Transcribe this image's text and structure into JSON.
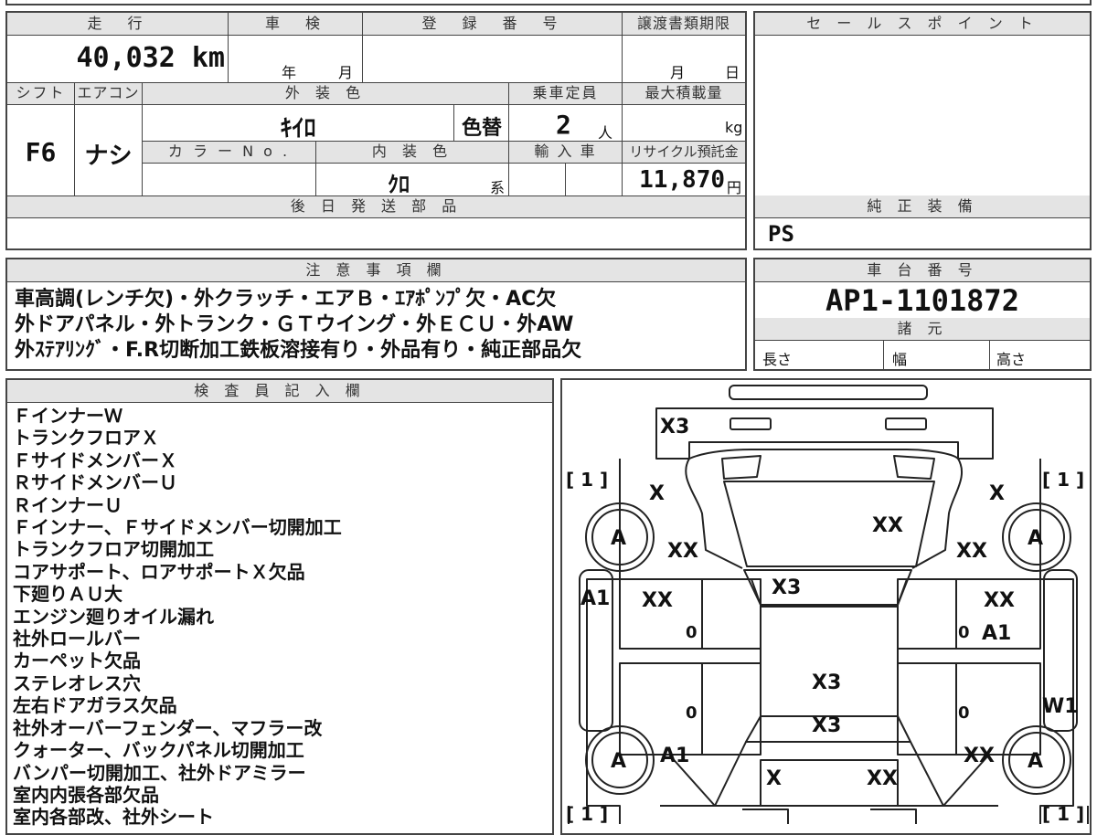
{
  "top_table": {
    "hdr_mileage": "走　行",
    "mileage": "40,032 km",
    "hdr_shaken": "車　検",
    "shaken_year": "年",
    "shaken_month": "月",
    "hdr_reg": "登　録　番　号",
    "hdr_transfer": "譲渡書類期限",
    "transfer_month": "月",
    "transfer_day": "日",
    "hdr_shift": "シフト",
    "shift": "F6",
    "hdr_ac": "エアコン",
    "ac": "ナシ",
    "hdr_exterior": "外 装 色",
    "exterior_color": "ｷｲﾛ",
    "color_change": "色替",
    "hdr_capacity": "乗車定員",
    "capacity": "2",
    "capacity_unit": "人",
    "hdr_maxload": "最大積載量",
    "maxload_unit": "kg",
    "hdr_colorno": "カ ラ ー N o .",
    "hdr_interior": "内 装 色",
    "interior_color": "ｸﾛ",
    "interior_suffix": "系",
    "hdr_import": "輸 入 車",
    "hdr_recycle": "リサイクル預託金",
    "recycle": "11,870",
    "recycle_unit": "円",
    "hdr_later_parts": "後 日 発 送 部 品"
  },
  "sales_point": {
    "header": "セ ー ル ス ポ イ ン ト"
  },
  "genuine_equipment": {
    "header": "純 正 装 備",
    "value": "PS"
  },
  "notes": {
    "header": "注 意 事 項 欄",
    "lines": [
      "車高調(レンチ欠)・外クラッチ・エアＢ・ｴｱﾎﾟﾝﾌﾟ欠・AC欠",
      "外ドアパネル・外トランク・ＧＴウイング・外ＥＣＵ・外AW",
      "外ｽﾃｱﾘﾝｸﾞ・F.R切断加工鉄板溶接有り・外品有り・純正部品欠"
    ]
  },
  "chassis": {
    "header": "車 台 番 号",
    "number": "AP1-1101872",
    "spec_header": "諸 元",
    "length": "長さ",
    "width": "幅",
    "height": "高さ"
  },
  "inspector": {
    "header": "検 査 員 記 入 欄",
    "lines": [
      "ＦインナーＷ",
      "トランクフロアＸ",
      "ＦサイドメンバーＸ",
      "ＲサイドメンバーＵ",
      "ＲインナーＵ",
      "Ｆインナー、Ｆサイドメンバー切開加工",
      "トランクフロア切開加工",
      "コアサポート、ロアサポートＸ欠品",
      "下廻りＡＵ大",
      "エンジン廻りオイル漏れ",
      "社外ロールバー",
      "カーペット欠品",
      "ステレオレス穴",
      "左右ドアガラス欠品",
      "社外オーバーフェンダー、マフラー改",
      "クォーター、バックパネル切開加工",
      "バンパー切開加工、社外ドアミラー",
      "室内内張各部欠品",
      "室内各部改、社外シート"
    ]
  },
  "diagram": {
    "marks": {
      "rear_bumper": "X3",
      "left_rear_quarter": "X",
      "right_rear_quarter": "X",
      "left_rear_wheel": "A",
      "right_rear_wheel": "A",
      "trunk": "XX",
      "left_rear_fender": "XX",
      "right_rear_fender": "XX",
      "rear_roof": "X3",
      "left_rocker": "A1",
      "left_rear_door": "XX",
      "right_rear_door": "XX",
      "left_door_glass_r": "0",
      "right_door_glass_r": "0",
      "right_pillar": "A1",
      "roof": "X3",
      "left_door_glass_f": "0",
      "right_door_glass_f": "0",
      "windshield": "X3",
      "right_rocker": "W1",
      "left_front_wheel": "A",
      "right_front_wheel": "A",
      "left_front_fender": "A1",
      "right_front_fender": "XX",
      "hood_left": "X",
      "hood_right": "XX",
      "bracket_tl": "[ 1 ]",
      "bracket_tr": "[ 1 ]",
      "bracket_bl": "[ 1 ]",
      "bracket_br": "[ 1 ]"
    }
  }
}
